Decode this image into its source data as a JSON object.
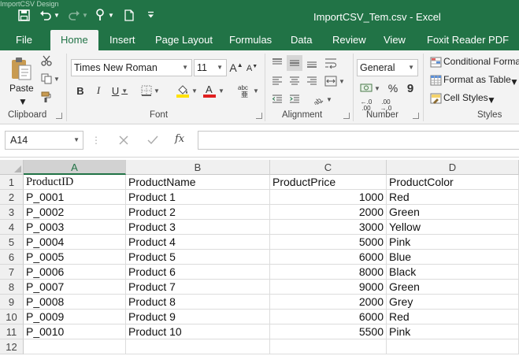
{
  "window": {
    "title": "ImportCSV_Tem.csv - Excel",
    "ghost_text": "ImportCSV Design"
  },
  "tabs": [
    {
      "label": "File"
    },
    {
      "label": "Home"
    },
    {
      "label": "Insert"
    },
    {
      "label": "Page Layout"
    },
    {
      "label": "Formulas"
    },
    {
      "label": "Data"
    },
    {
      "label": "Review"
    },
    {
      "label": "View"
    },
    {
      "label": "Foxit Reader PDF"
    }
  ],
  "ribbon": {
    "clipboard": {
      "paste_label": "Paste",
      "group_label": "Clipboard"
    },
    "font": {
      "family": "Times New Roman",
      "size": "11",
      "group_label": "Font"
    },
    "alignment": {
      "group_label": "Alignment"
    },
    "number": {
      "format": "General",
      "group_label": "Number"
    },
    "styles": {
      "conditional_formatting": "Conditional Formatting",
      "format_as_table": "Format as Table",
      "cell_styles": "Cell Styles",
      "group_label": "Styles"
    }
  },
  "formula_bar": {
    "name_box": "A14",
    "fx_label": "fx",
    "value": ""
  },
  "sheet": {
    "columns": [
      "A",
      "B",
      "C",
      "D"
    ],
    "selected_column": "A",
    "rows": [
      {
        "num": "1",
        "cells": [
          "ProductID",
          "ProductName",
          "ProductPrice",
          "ProductColor"
        ]
      },
      {
        "num": "2",
        "cells": [
          "P_0001",
          "Product 1",
          "1000",
          "Red"
        ]
      },
      {
        "num": "3",
        "cells": [
          "P_0002",
          "Product 2",
          "2000",
          "Green"
        ]
      },
      {
        "num": "4",
        "cells": [
          "P_0003",
          "Product 3",
          "3000",
          "Yellow"
        ]
      },
      {
        "num": "5",
        "cells": [
          "P_0004",
          "Product 4",
          "5000",
          "Pink"
        ]
      },
      {
        "num": "6",
        "cells": [
          "P_0005",
          "Product 5",
          "6000",
          "Blue"
        ]
      },
      {
        "num": "7",
        "cells": [
          "P_0006",
          "Product 6",
          "8000",
          "Black"
        ]
      },
      {
        "num": "8",
        "cells": [
          "P_0007",
          "Product 7",
          "9000",
          "Green"
        ]
      },
      {
        "num": "9",
        "cells": [
          "P_0008",
          "Product 8",
          "2000",
          "Grey"
        ]
      },
      {
        "num": "10",
        "cells": [
          "P_0009",
          "Product 9",
          "6000",
          "Red"
        ]
      },
      {
        "num": "11",
        "cells": [
          "P_0010",
          "Product 10",
          "5500",
          "Pink"
        ]
      },
      {
        "num": "12",
        "cells": [
          "",
          "",
          "",
          ""
        ]
      }
    ]
  },
  "colors": {
    "accent": "#217346",
    "font_color_bar": "#e02020",
    "fill_color_bar": "#ffe100"
  }
}
